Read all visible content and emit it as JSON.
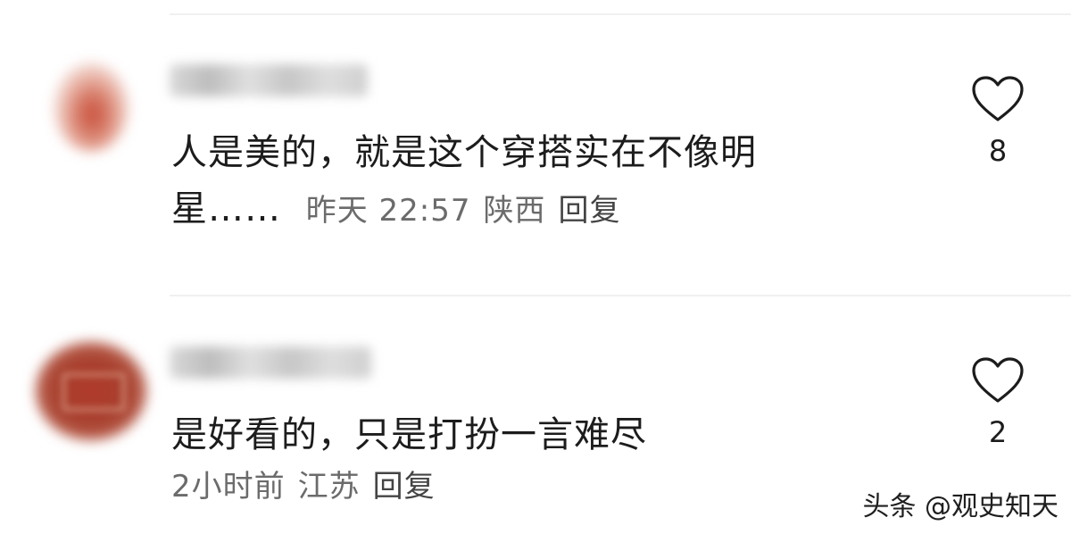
{
  "comments": [
    {
      "text_line1": "人是美的，就是这个穿搭实在不像明",
      "text_line2": "星……",
      "time": "昨天 22:57",
      "location": "陕西",
      "reply_label": "回复",
      "like_count": "8"
    },
    {
      "text_line1": "是好看的，只是打扮一言难尽",
      "time": "2小时前",
      "location": "江苏",
      "reply_label": "回复",
      "like_count": "2"
    }
  ],
  "watermark": "头条 @观史知天",
  "icons": {
    "like": "heart-outline-icon"
  },
  "colors": {
    "text": "#1c1c1c",
    "meta": "#6b6b6b",
    "divider": "#f0f0f0"
  }
}
